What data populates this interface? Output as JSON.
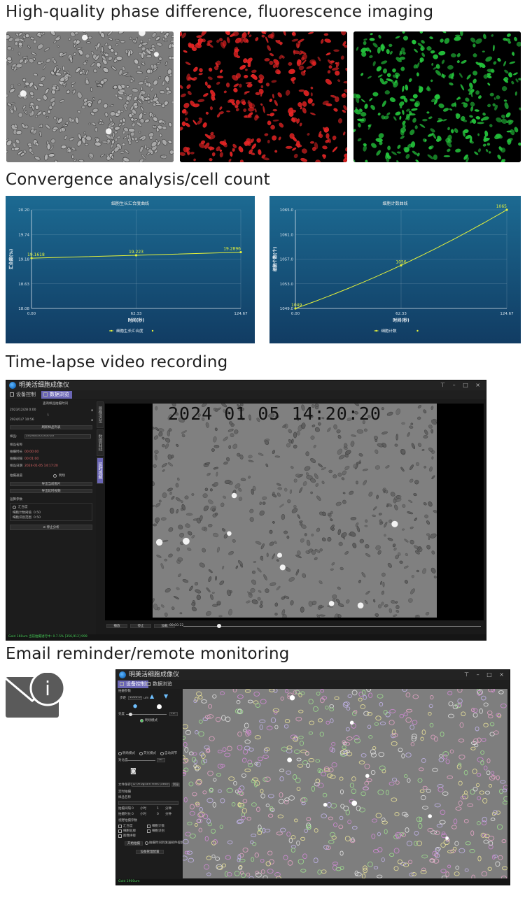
{
  "sections": {
    "imaging": {
      "title": "High-quality phase difference, fluorescence imaging"
    },
    "convergence": {
      "title": "Convergence analysis/cell count"
    },
    "timelapse": {
      "title": "Time-lapse video recording"
    },
    "email": {
      "title": "Email reminder/remote monitoring"
    }
  },
  "colors": {
    "chart_bg_top": "#1c6a92",
    "chart_bg_bottom": "#113c63",
    "chart_line": "#e6f23a",
    "accent_tab": "#6b66b5",
    "red_channel": "#e02020",
    "green_channel": "#22c43a"
  },
  "chart_data": [
    {
      "type": "line",
      "title": "细胞生长汇合度曲线",
      "xlabel": "时间(秒)",
      "ylabel": "汇合度(%)",
      "x": [
        0.0,
        62.33,
        124.67
      ],
      "series": [
        {
          "name": "细胞生长汇合度",
          "values": [
            19.1618,
            19.223,
            19.2896
          ],
          "labels": [
            "19.1618",
            "19.223",
            "19.2896"
          ]
        }
      ],
      "xticks": [
        "0.00",
        "62.33",
        "124.67"
      ],
      "yticks": [
        "20.20",
        "19.74",
        "19.18",
        "18.63",
        "18.08"
      ],
      "xlim": [
        0.0,
        124.67
      ],
      "ylim": [
        18.08,
        20.2
      ],
      "grid": true,
      "legend": "bottom-center"
    },
    {
      "type": "line",
      "title": "细胞计数曲线",
      "xlabel": "时间(秒)",
      "ylabel": "细胞个数(个)",
      "x": [
        0.0,
        62.33,
        124.67
      ],
      "series": [
        {
          "name": "细胞计数",
          "values": [
            1049,
            1056,
            1065
          ],
          "labels": [
            "1049",
            "1056",
            "1065"
          ]
        }
      ],
      "xticks": [
        "0.00",
        "62.33",
        "124.67"
      ],
      "yticks": [
        "1065.0",
        "1061.0",
        "1057.0",
        "1053.0",
        "1049.0"
      ],
      "xlim": [
        0.0,
        124.67
      ],
      "ylim": [
        1049,
        1065
      ],
      "grid": true,
      "legend": "bottom-center"
    }
  ],
  "app1": {
    "title": "明美活细胞成像仪",
    "window_controls": "⊤ – □ ×",
    "tabs": [
      {
        "label": "设备控制",
        "active": false
      },
      {
        "label": "数据浏览",
        "active": true
      }
    ],
    "side_tabs": [
      "图像浏览",
      "数据曲线",
      "延时视频"
    ],
    "panel": {
      "date_start": "2023/12/28 0:00",
      "date_end": "2024/1/7 10:56",
      "query_label": "查询样品拍摄时间",
      "list_button": "刷新样品列表",
      "sample_label": "样品:",
      "sample_value": "20240105143720",
      "sample_name_label": "样品名称",
      "shoot_interval_label": "拍摄时长",
      "shoot_interval_value": "00:00:00",
      "shoot_count_label": "拍摄间隔",
      "shoot_count_value": "00:01:00",
      "sample_date_label": "样品日期",
      "sample_date_value": "2024-01-05 14:17:20",
      "channel_label": "拍摄通道",
      "channel_value": "明场",
      "export_image_button": "导出当前图片",
      "export_video_button": "导出延时视频",
      "analysis_label": "运算参数",
      "confluence_label": "汇合度",
      "param1_label": "细胞计数阈值",
      "param1_value": "0.50",
      "param2_label": "细胞识别范围",
      "param2_value": "0.50",
      "stop_button": "停止分析"
    },
    "viewer_timestamp": "2024 01 05 14:20:20",
    "playback": {
      "play_label": "播放",
      "stop_label": "停止",
      "speed_label": "加载",
      "time_value": "00:00:22"
    },
    "status_text": "Gold  160um  当前拍摄进行中: 0.7.5% [356,912] 999"
  },
  "app2": {
    "title": "明美活细胞成像仪",
    "window_controls": "⊤ – □ ×",
    "tabs": [
      {
        "label": "设备控制",
        "active": true
      },
      {
        "label": "数据浏览",
        "active": false
      }
    ],
    "panel": {
      "section_label": "拍摄参数",
      "exposure_label": "步距",
      "exposure_value": "1000.00",
      "exposure_unit": "um",
      "brightness_label": "亮度",
      "brightness_value": "70",
      "bright_field_label": "明场模式",
      "mode_label_1": "明场模式",
      "mode_label_2": "荧光模式",
      "mode_label_3": "自动调节",
      "contrast_label": "对比度",
      "contrast_value": "50",
      "save_path_label": "文件保存路径",
      "save_path_value": "D:\\Program Files (x86)\\CellClient",
      "browse_button": "浏览",
      "timer_label": "定时拍摄",
      "sample_name_label": "样品名称",
      "interval_label": "拍摄间隔",
      "duration_label": "拍摄时长",
      "interval_h": "0",
      "interval_m": "1",
      "interval_unit_h": "小时",
      "interval_unit_m": "分钟",
      "duration_h": "0",
      "duration_m": "0",
      "duration_unit_h": "小时",
      "duration_unit_m": "分钟",
      "opt_label": "视野拍摄参数",
      "opt1_label": "汇合度",
      "opt2_label": "细胞计数",
      "opt3_label": "细胞轮廓",
      "opt4_label": "细胞识别",
      "opt5_label": "图像拼接",
      "start_button": "开始拍摄",
      "email_check_label": "拍摄时间到发送邮件提醒",
      "email_button": "设备管理配置"
    },
    "status_text": "Gold  1900um"
  },
  "email_icon": {
    "name": "email-info-icon",
    "color": "#5a5a5a",
    "glyph": "i"
  }
}
